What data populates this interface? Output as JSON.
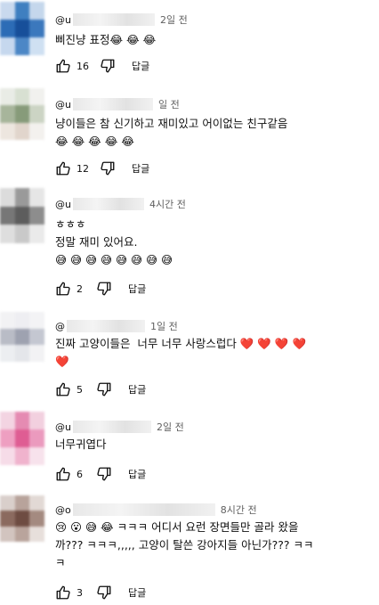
{
  "comments": [
    {
      "handle": "@u",
      "time": "2일 전",
      "text": "삐진냥 표정😂 😂 😂",
      "likes": "16",
      "reply_label": "답글",
      "avatar_colors": [
        "#c9d9ee",
        "#3f7fc0",
        "#c5d7ec",
        "#2c6cb6",
        "#174f9a",
        "#3b78bd",
        "#c6d8ee",
        "#4c87c6",
        "#cfe0f2"
      ]
    },
    {
      "handle": "@u",
      "time": "일 전",
      "text": "냥이들은 참 신기하고 재미있고 어이없는 친구같음\n😂 😂 😂 😂 😂",
      "likes": "12",
      "reply_label": "답글",
      "avatar_colors": [
        "#e9ece6",
        "#d8e0d2",
        "#f1f1ee",
        "#a7b59b",
        "#879b7a",
        "#ccd4c4",
        "#ede6df",
        "#e1d5cc",
        "#f3f1ee"
      ]
    },
    {
      "handle": "@u",
      "time": "4시간 전",
      "text": "ㅎㅎㅎ\n정말 재미 있어요.\n😅 😅 😅 😅 😅 😅 😅 😅",
      "likes": "2",
      "reply_label": "답글",
      "avatar_colors": [
        "#dcdcdc",
        "#9a9a9a",
        "#e6e6e6",
        "#777777",
        "#5d5d5d",
        "#8d8d8d",
        "#dedede",
        "#c9c9c9",
        "#eaeaea"
      ]
    },
    {
      "handle": "@",
      "time": "1일 전",
      "text": "진짜 고양이들은  너무 너무 사랑스럽다 ❤️ ❤️ ❤️ ❤️\n❤️",
      "likes": "5",
      "reply_label": "답글",
      "avatar_colors": [
        "#f2f2f4",
        "#eeeef2",
        "#f3f3f5",
        "#b9bcc6",
        "#9ea2b0",
        "#c4c7d1",
        "#eceef1",
        "#e4e6ea",
        "#f2f2f4"
      ]
    },
    {
      "handle": "@u",
      "time": "2일 전",
      "text": "너무귀엽다",
      "likes": "6",
      "reply_label": "답글",
      "avatar_colors": [
        "#f3d4e2",
        "#e58bb2",
        "#f2d0df",
        "#ee9fc1",
        "#df5d93",
        "#eb9abe",
        "#f6dce8",
        "#f0b3cd",
        "#f7e2ec"
      ]
    },
    {
      "handle": "@o",
      "time": "8시간 전",
      "text": "😢 😮 😅 😂 ㅋㅋㅋ 어디서 요런 장면들만 골라 왔을\n까??? ㅋㅋㅋ,,,,, 고양이 탈쓴 강아지들 아닌가??? ㅋㅋ\nㅋ",
      "likes": "3",
      "reply_label": "답글",
      "avatar_colors": [
        "#d9cfcb",
        "#b8a39b",
        "#e2d9d5",
        "#8b6a5f",
        "#6e4c42",
        "#a48a80",
        "#d2c4bf",
        "#b9a49c",
        "#e7dfdb"
      ]
    }
  ],
  "icons": {
    "like": "thumbs-up-icon",
    "dislike": "thumbs-down-icon"
  }
}
